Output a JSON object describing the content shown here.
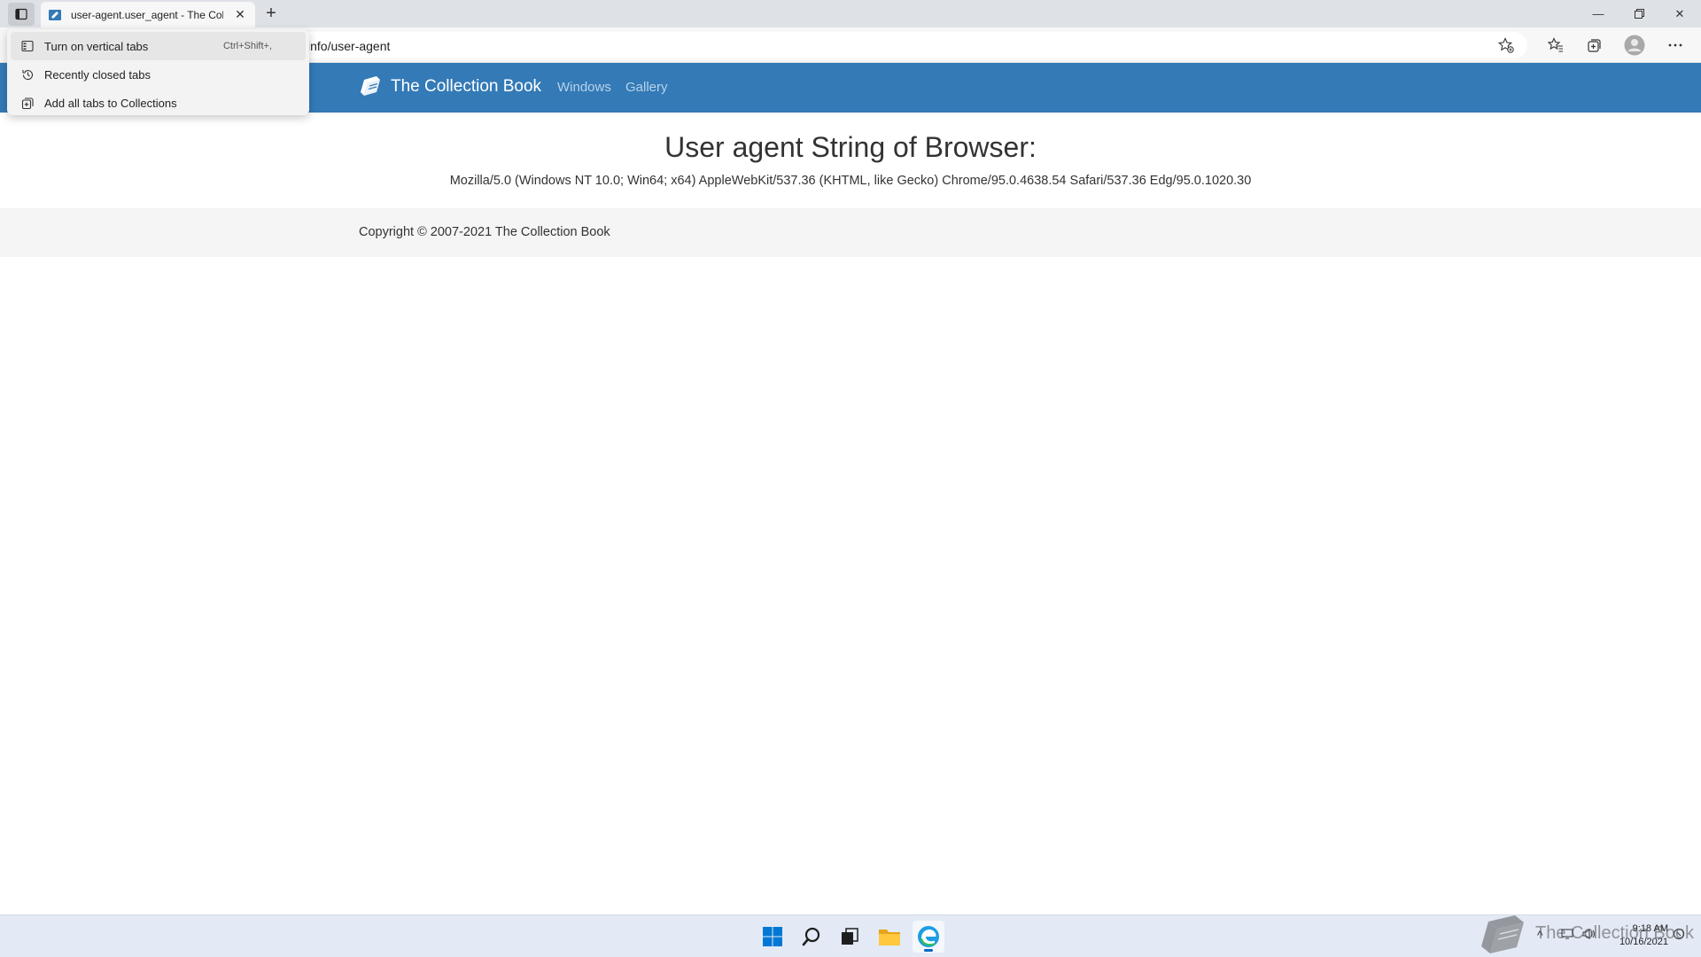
{
  "browser": {
    "tab": {
      "title": "user-agent.user_agent - The Collection Book"
    },
    "address_bar": {
      "visible_text": "info/user-agent"
    }
  },
  "tab_actions_menu": {
    "items": [
      {
        "label": "Turn on vertical tabs",
        "shortcut": "Ctrl+Shift+,",
        "icon": "vertical-tabs-icon"
      },
      {
        "label": "Recently closed tabs",
        "icon": "history-icon"
      },
      {
        "label": "Add all tabs to Collections",
        "icon": "collections-add-icon"
      }
    ]
  },
  "page": {
    "brand": "The Collection Book",
    "nav": [
      "Windows",
      "Gallery"
    ],
    "heading": "User agent String of Browser:",
    "user_agent": "Mozilla/5.0 (Windows NT 10.0; Win64; x64) AppleWebKit/537.36 (KHTML, like Gecko) Chrome/95.0.4638.54 Safari/537.36 Edg/95.0.1020.30",
    "footer": "Copyright © 2007-2021 The Collection Book"
  },
  "taskbar": {
    "clock": {
      "time": "9:18 AM",
      "date": "10/16/2021"
    },
    "watermark": "The Collection Book"
  },
  "colors": {
    "navbar": "#337ab7",
    "taskbar": "#e3eaf6",
    "chrome": "#dee1e6"
  }
}
